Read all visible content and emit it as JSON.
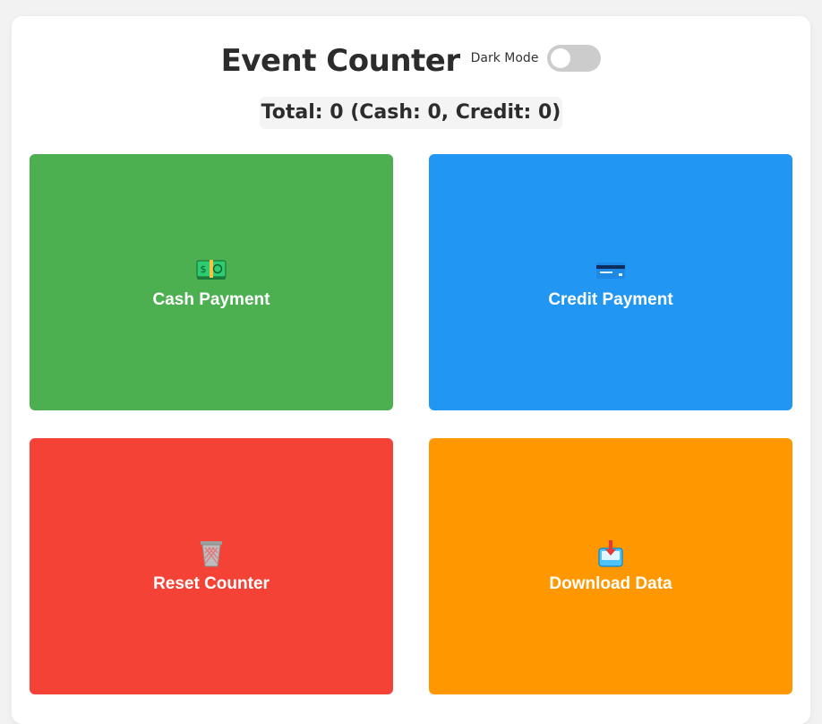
{
  "header": {
    "title": "Event Counter",
    "dark_mode_label": "Dark Mode",
    "dark_mode_on": false
  },
  "summary": {
    "text": "Total: 0 (Cash: 0, Credit: 0)"
  },
  "buttons": [
    {
      "label": "Cash Payment",
      "icon": "money-icon",
      "color": "#4caf50"
    },
    {
      "label": "Credit Payment",
      "icon": "credit-card-icon",
      "color": "#2196f3"
    },
    {
      "label": "Reset Counter",
      "icon": "wastebasket-icon",
      "color": "#f44336"
    },
    {
      "label": "Download Data",
      "icon": "inbox-download-icon",
      "color": "#ff9800"
    }
  ]
}
